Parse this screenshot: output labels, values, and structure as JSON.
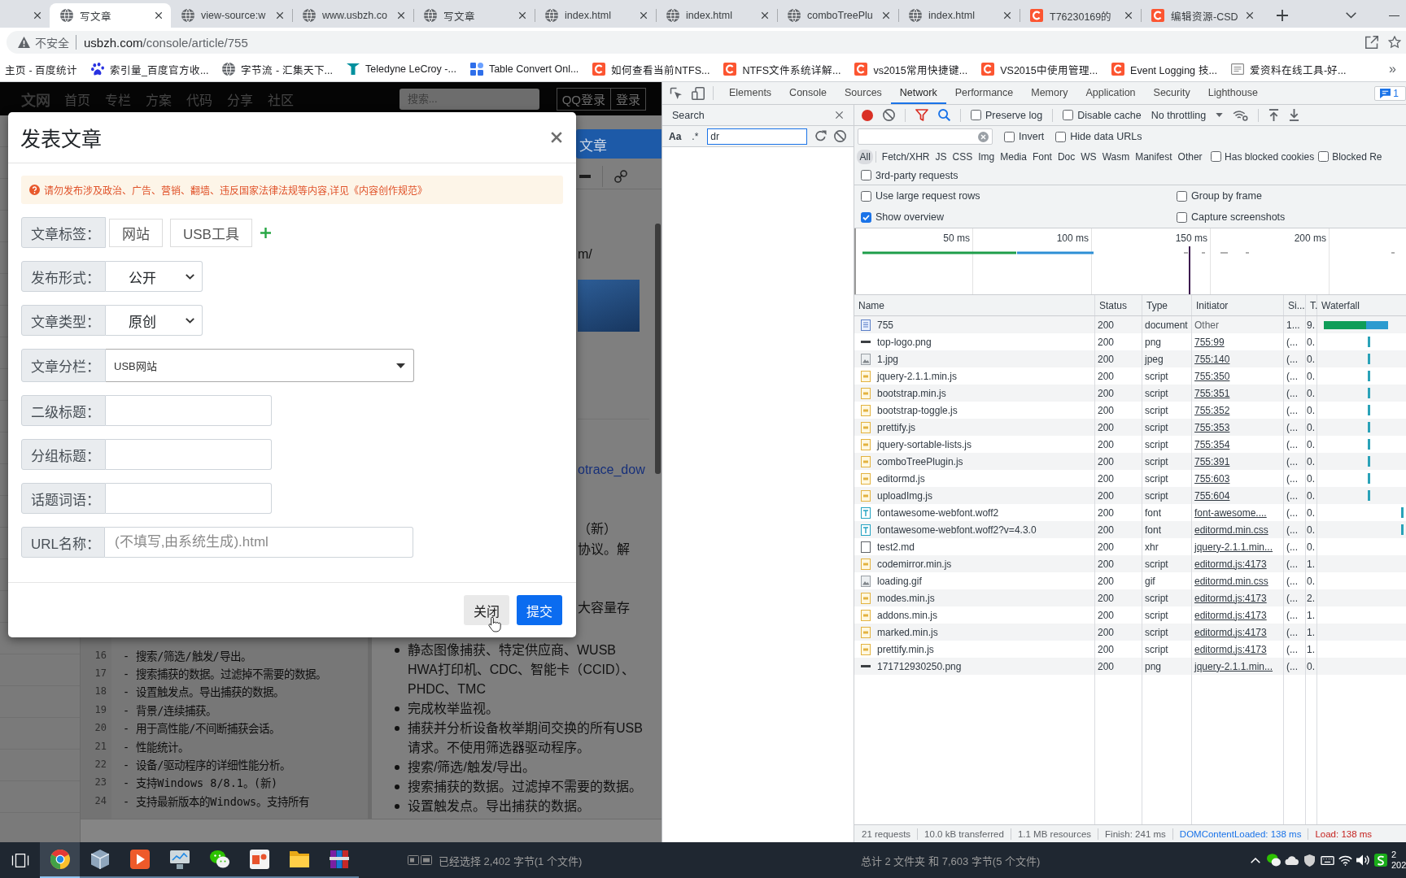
{
  "browser": {
    "tabs": [
      {
        "selected": false
      },
      {
        "title": "写文章",
        "kind": "globe",
        "selected": true
      },
      {
        "title": "view-source:w",
        "kind": "globe",
        "selected": false
      },
      {
        "title": "www.usbzh.co",
        "kind": "globe",
        "selected": false
      },
      {
        "title": "写文章",
        "kind": "globe",
        "selected": false
      },
      {
        "title": "index.html",
        "kind": "globe",
        "selected": false
      },
      {
        "title": "index.html",
        "kind": "globe",
        "selected": false
      },
      {
        "title": "comboTreePlu",
        "kind": "globe",
        "selected": false
      },
      {
        "title": "index.html",
        "kind": "globe",
        "selected": false
      },
      {
        "title": "T76230169的",
        "kind": "csdn",
        "selected": false
      },
      {
        "title": "编辑资源-CSD",
        "kind": "csdn",
        "selected": false
      }
    ],
    "address": {
      "security": "不安全",
      "host": "usbzh.com",
      "path": "/console/article/755"
    },
    "bookmarks": [
      {
        "label": "主页 - 百度统计"
      },
      {
        "label": "索引量_百度官方收...",
        "kind": "paw"
      },
      {
        "label": "字节流 - 汇集天下...",
        "kind": "globe"
      },
      {
        "label": "Teledyne LeCroy -...",
        "kind": "wave"
      },
      {
        "label": "Table Convert Onl...",
        "kind": "grid"
      },
      {
        "label": "如何查看当前NTFS...",
        "kind": "csdn"
      },
      {
        "label": "NTFS文件系统详解...",
        "kind": "csdn"
      },
      {
        "label": "vs2015常用快捷键...",
        "kind": "csdn"
      },
      {
        "label": "VS2015中使用管理...",
        "kind": "csdn"
      },
      {
        "label": "Event Logging 技...",
        "kind": "csdn"
      },
      {
        "label": "爱资料在线工具-好...",
        "kind": "doc"
      }
    ],
    "bookmarks_overflow": "»"
  },
  "site": {
    "logo": "文网",
    "nav": [
      "首页",
      "专栏",
      "方案",
      "代码",
      "分享",
      "社区"
    ],
    "search_placeholder": "搜索...",
    "buttons": [
      "QQ登录",
      "登录"
    ],
    "write_button": "文章",
    "fragments": [
      {
        "kind": "text",
        "text": "m/"
      },
      {
        "kind": "image"
      },
      {
        "kind": "rule"
      },
      {
        "kind": "link",
        "text": "otrace_dow"
      },
      {
        "kind": "text",
        "text": "（新）"
      },
      {
        "kind": "text",
        "text": "协议。解"
      },
      {
        "kind": "text",
        "text": "大容量存"
      }
    ],
    "code_lines": [
      {
        "number": "16",
        "text": "- 搜索/筛选/触发/导出。"
      },
      {
        "number": "17",
        "text": "- 搜索捕获的数据。过滤掉不需要的数据。"
      },
      {
        "number": "18",
        "text": "- 设置触发点。导出捕获的数据。"
      },
      {
        "number": "19",
        "text": "- 背景/连续捕获。"
      },
      {
        "number": "20",
        "text": "- 用于高性能/不间断捕获会话。"
      },
      {
        "number": "21",
        "text": "- 性能统计。"
      },
      {
        "number": "22",
        "text": "- 设备/驱动程序的详细性能分析。"
      },
      {
        "number": "23",
        "text": "- 支持Windows 8/8.1。(新)"
      },
      {
        "number": "24",
        "text": "- 支持最新版本的Windows。支持所有"
      }
    ],
    "preview_items": [
      "静态图像捕获、特定供应商、WUSB\nHWA打印机、CDC、智能卡（CCID）、\nPHDC、TMC",
      "完成枚举监视。",
      "捕获并分析设备枚举期间交换的所有USB\n请求。不使用筛选器驱动程序。",
      "搜索/筛选/触发/导出。",
      "搜索捕获的数据。过滤掉不需要的数据。",
      "设置触发点。导出捕获的数据。"
    ]
  },
  "modal": {
    "title": "发表文章",
    "alert": "请勿发布涉及政治、广告、营销、翻墙、违反国家法律法规等内容,详见《内容创作规范》",
    "fields": [
      {
        "kind": "tags",
        "label": "文章标签：",
        "tags": [
          "网站",
          "USB工具"
        ]
      },
      {
        "kind": "select",
        "label": "发布形式：",
        "value": "公开"
      },
      {
        "kind": "select",
        "label": "文章类型：",
        "value": "原创"
      },
      {
        "kind": "combo",
        "label": "文章分栏：",
        "value": "USB网站"
      },
      {
        "kind": "input",
        "label": "二级标题："
      },
      {
        "kind": "input",
        "label": "分组标题："
      },
      {
        "kind": "input",
        "label": "话题词语："
      },
      {
        "kind": "url",
        "label": "URL名称：",
        "placeholder": "(不填写,由系统生成).html"
      }
    ],
    "buttons": [
      {
        "kind": "secondary",
        "label": "关闭"
      },
      {
        "kind": "primary",
        "label": "提交"
      }
    ]
  },
  "devtools": {
    "tabs": [
      {
        "label": "Elements",
        "selected": false
      },
      {
        "label": "Console",
        "selected": false
      },
      {
        "label": "Sources",
        "selected": false
      },
      {
        "label": "Network",
        "selected": true
      },
      {
        "label": "Performance",
        "selected": false
      },
      {
        "label": "Memory",
        "selected": false
      },
      {
        "label": "Application",
        "selected": false
      },
      {
        "label": "Security",
        "selected": false
      },
      {
        "label": "Lighthouse",
        "selected": false
      }
    ],
    "issues_count": "1",
    "search": {
      "title": "Search",
      "case_label": "Aa",
      "regex_label": ".*",
      "query": "dr"
    },
    "network": {
      "toolbar": {
        "options": [
          {
            "label": "Preserve log",
            "checked": false
          },
          {
            "label": "Disable cache",
            "checked": false
          }
        ],
        "throttling": "No throttling"
      },
      "filter_bar": {
        "options": [
          {
            "label": "Invert",
            "checked": false
          },
          {
            "label": "Hide data URLs",
            "checked": false
          }
        ]
      },
      "type_filters": [
        {
          "label": "All",
          "selected": true
        },
        {
          "label": "Fetch/XHR",
          "selected": false
        },
        {
          "label": "JS",
          "selected": false
        },
        {
          "label": "CSS",
          "selected": false
        },
        {
          "label": "Img",
          "selected": false
        },
        {
          "label": "Media",
          "selected": false
        },
        {
          "label": "Font",
          "selected": false
        },
        {
          "label": "Doc",
          "selected": false
        },
        {
          "label": "WS",
          "selected": false
        },
        {
          "label": "Wasm",
          "selected": false
        },
        {
          "label": "Manifest",
          "selected": false
        },
        {
          "label": "Other",
          "selected": false
        }
      ],
      "type_options": [
        {
          "label": "Has blocked cookies",
          "checked": false
        },
        {
          "label": "Blocked Re",
          "checked": false
        }
      ],
      "third_party": {
        "label": "3rd-party requests",
        "checked": false
      },
      "settings": [
        {
          "label": "Use large request rows",
          "checked": false
        },
        {
          "label": "Group by frame",
          "checked": false
        },
        {
          "label": "Show overview",
          "checked": true
        },
        {
          "label": "Capture screenshots",
          "checked": false
        }
      ],
      "overview": {
        "ticks": [
          "50 ms",
          "100 ms",
          "150 ms",
          "200 ms"
        ]
      },
      "columns": [
        "Name",
        "Status",
        "Type",
        "Initiator",
        "Si...",
        "T.",
        "Waterfall"
      ],
      "rows": [
        {
          "kind": "document",
          "name": "755",
          "status": "200",
          "type": "document",
          "initiator": "Other",
          "link": false,
          "size": "1...",
          "time": "9.",
          "waterfall": {
            "kind": "bar"
          }
        },
        {
          "kind": "dash",
          "name": "top-logo.png",
          "status": "200",
          "type": "png",
          "initiator": "755:99",
          "link": true,
          "size": "(...",
          "time": "0.",
          "waterfall": {
            "kind": "tick"
          }
        },
        {
          "kind": "image",
          "name": "1.jpg",
          "status": "200",
          "type": "jpeg",
          "initiator": "755:140",
          "link": true,
          "size": "(...",
          "time": "0.",
          "waterfall": {
            "kind": "tick"
          }
        },
        {
          "kind": "script",
          "name": "jquery-2.1.1.min.js",
          "status": "200",
          "type": "script",
          "initiator": "755:350",
          "link": true,
          "size": "(...",
          "time": "0.",
          "waterfall": {
            "kind": "tick"
          }
        },
        {
          "kind": "script",
          "name": "bootstrap.min.js",
          "status": "200",
          "type": "script",
          "initiator": "755:351",
          "link": true,
          "size": "(...",
          "time": "0.",
          "waterfall": {
            "kind": "tick"
          }
        },
        {
          "kind": "script",
          "name": "bootstrap-toggle.js",
          "status": "200",
          "type": "script",
          "initiator": "755:352",
          "link": true,
          "size": "(...",
          "time": "0.",
          "waterfall": {
            "kind": "tick"
          }
        },
        {
          "kind": "script",
          "name": "prettify.js",
          "status": "200",
          "type": "script",
          "initiator": "755:353",
          "link": true,
          "size": "(...",
          "time": "0.",
          "waterfall": {
            "kind": "tick"
          }
        },
        {
          "kind": "script",
          "name": "jquery-sortable-lists.js",
          "status": "200",
          "type": "script",
          "initiator": "755:354",
          "link": true,
          "size": "(...",
          "time": "0.",
          "waterfall": {
            "kind": "tick"
          }
        },
        {
          "kind": "script",
          "name": "comboTreePlugin.js",
          "status": "200",
          "type": "script",
          "initiator": "755:391",
          "link": true,
          "size": "(...",
          "time": "0.",
          "waterfall": {
            "kind": "tick"
          }
        },
        {
          "kind": "script",
          "name": "editormd.js",
          "status": "200",
          "type": "script",
          "initiator": "755:603",
          "link": true,
          "size": "(...",
          "time": "0.",
          "waterfall": {
            "kind": "tick"
          }
        },
        {
          "kind": "script",
          "name": "uploadImg.js",
          "status": "200",
          "type": "script",
          "initiator": "755:604",
          "link": true,
          "size": "(...",
          "time": "0.",
          "waterfall": {
            "kind": "tick"
          }
        },
        {
          "kind": "font",
          "name": "fontawesome-webfont.woff2",
          "status": "200",
          "type": "font",
          "initiator": "font-awesome....",
          "link": true,
          "size": "(...",
          "time": "0.",
          "waterfall": {
            "kind": "late"
          }
        },
        {
          "kind": "font",
          "name": "fontawesome-webfont.woff2?v=4.3.0",
          "status": "200",
          "type": "font",
          "initiator": "editormd.min.css",
          "link": true,
          "size": "(...",
          "time": "0.",
          "waterfall": {
            "kind": "late"
          }
        },
        {
          "kind": "blank",
          "name": "test2.md",
          "status": "200",
          "type": "xhr",
          "initiator": "jquery-2.1.1.min...",
          "link": true,
          "size": "(...",
          "time": "0."
        },
        {
          "kind": "script",
          "name": "codemirror.min.js",
          "status": "200",
          "type": "script",
          "initiator": "editormd.js:4173",
          "link": true,
          "size": "(...",
          "time": "1."
        },
        {
          "kind": "image",
          "name": "loading.gif",
          "status": "200",
          "type": "gif",
          "initiator": "editormd.min.css",
          "link": true,
          "size": "(...",
          "time": "0."
        },
        {
          "kind": "script",
          "name": "modes.min.js",
          "status": "200",
          "type": "script",
          "initiator": "editormd.js:4173",
          "link": true,
          "size": "(...",
          "time": "2."
        },
        {
          "kind": "script",
          "name": "addons.min.js",
          "status": "200",
          "type": "script",
          "initiator": "editormd.js:4173",
          "link": true,
          "size": "(...",
          "time": "1."
        },
        {
          "kind": "script",
          "name": "marked.min.js",
          "status": "200",
          "type": "script",
          "initiator": "editormd.js:4173",
          "link": true,
          "size": "(...",
          "time": "1."
        },
        {
          "kind": "script",
          "name": "prettify.min.js",
          "status": "200",
          "type": "script",
          "initiator": "editormd.js:4173",
          "link": true,
          "size": "(...",
          "time": "1."
        },
        {
          "kind": "dash",
          "name": "171712930250.png",
          "status": "200",
          "type": "png",
          "initiator": "jquery-2.1.1.min...",
          "link": true,
          "size": "(...",
          "time": "0."
        }
      ],
      "summary": [
        {
          "text": "21 requests",
          "color": "#5f6368"
        },
        {
          "text": "10.0 kB transferred",
          "color": "#5f6368"
        },
        {
          "text": "1.1 MB resources",
          "color": "#5f6368"
        },
        {
          "text": "Finish: 241 ms",
          "color": "#5f6368"
        },
        {
          "text": "DOMContentLoaded: 138 ms",
          "color": "#1a73e8"
        },
        {
          "text": "Load: 138 ms",
          "color": "#c5221f"
        }
      ]
    }
  },
  "taskbar": {
    "apps": [
      {
        "kind": "browser",
        "selected": true
      },
      {
        "kind": "cubes",
        "selected": false
      },
      {
        "kind": "play",
        "selected": false
      },
      {
        "kind": "monitor",
        "selected": false
      },
      {
        "kind": "chat",
        "selected": false
      },
      {
        "kind": "slides",
        "selected": false
      },
      {
        "kind": "folder",
        "selected": false
      },
      {
        "kind": "archive",
        "selected": false
      }
    ],
    "status_texts": [
      "已经选择 2,402 字节(1 个文件)",
      "总计 2 文件夹 和 7,603 字节(5 个文件)"
    ],
    "tray": [
      {
        "kind": "chevron"
      },
      {
        "kind": "chat"
      },
      {
        "kind": "cloud"
      },
      {
        "kind": "shield"
      },
      {
        "kind": "keyboard"
      },
      {
        "kind": "wifi"
      },
      {
        "kind": "speaker"
      },
      {
        "kind": "app"
      }
    ],
    "clock": {
      "time": "2",
      "date": "202"
    }
  }
}
